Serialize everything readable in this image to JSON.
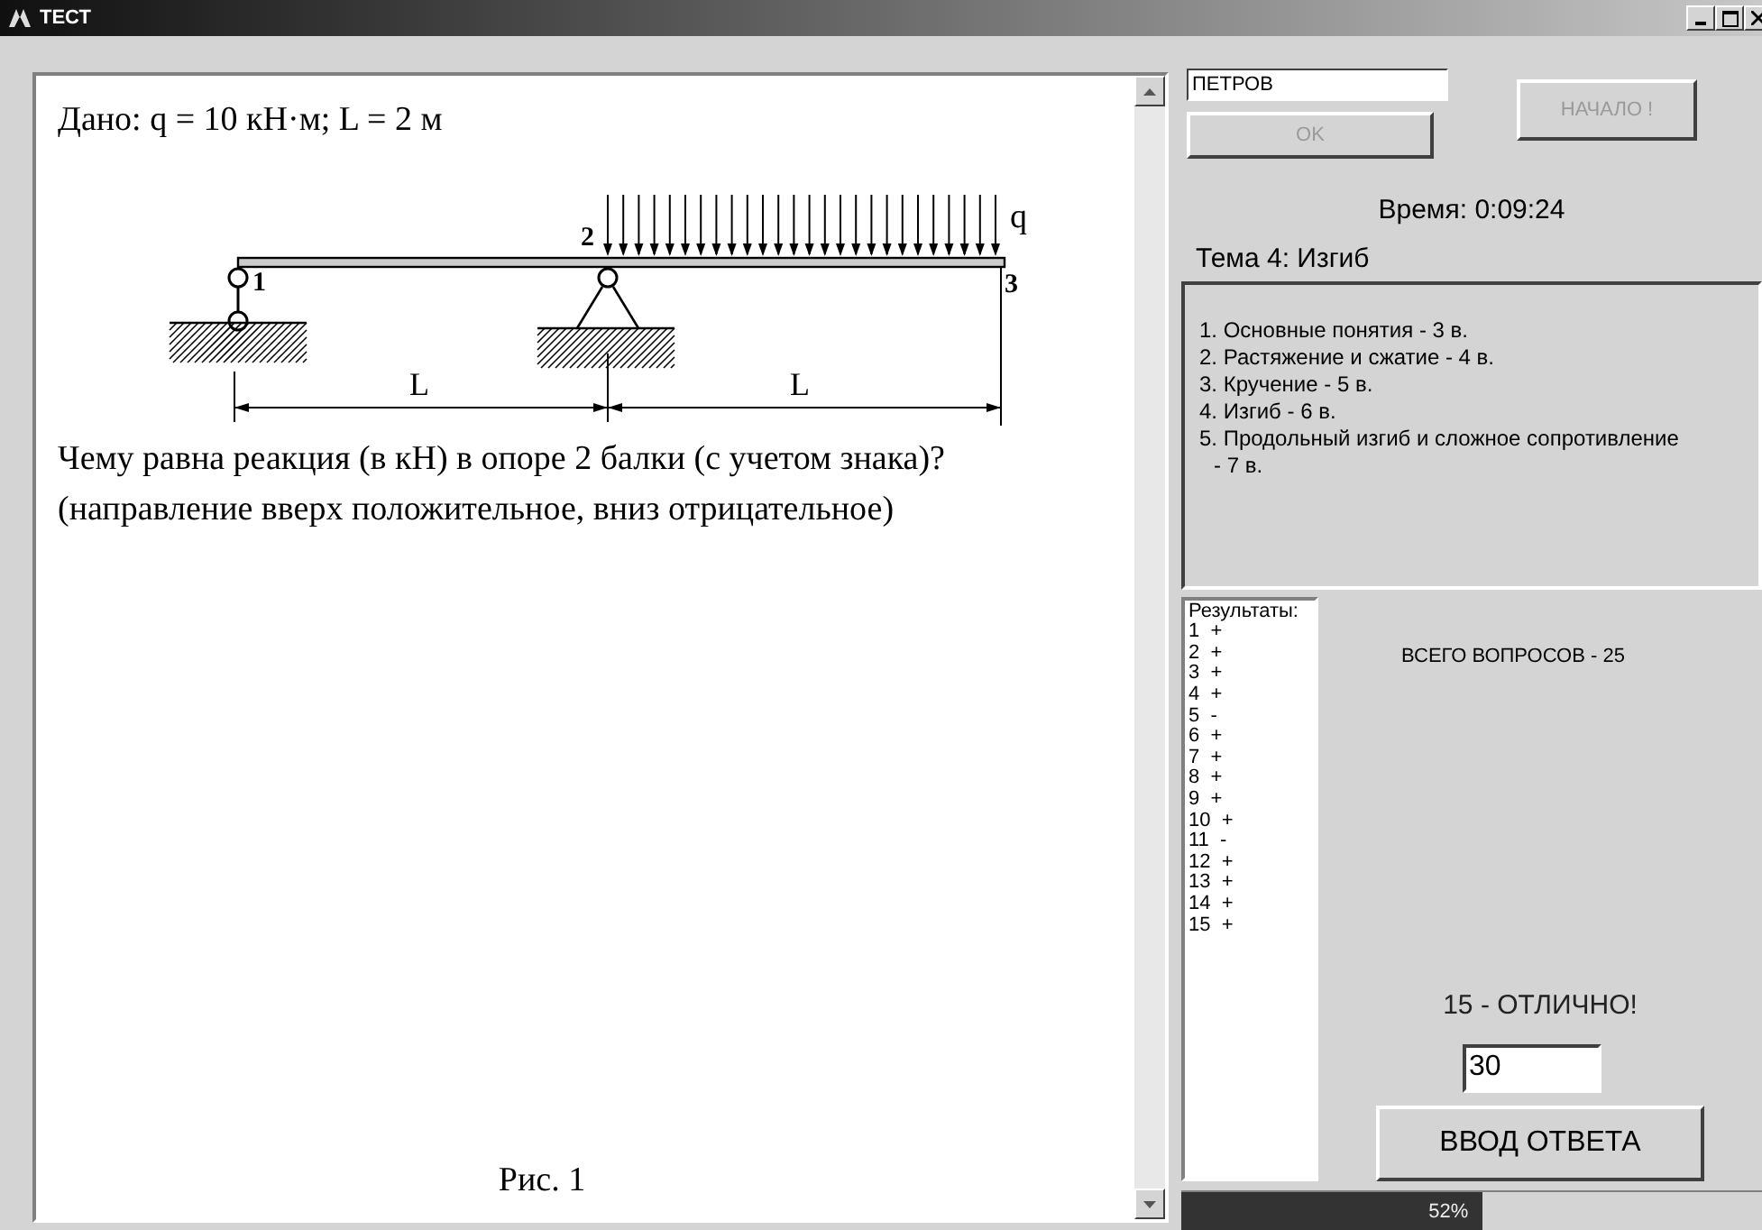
{
  "window": {
    "title": "ТЕСТ"
  },
  "question": {
    "given": "Дано: q = 10 кН·м; L = 2 м",
    "diagram": {
      "labels": {
        "node_1": "1",
        "node_2": "2",
        "node_3": "3",
        "load": "q",
        "span_1": "L",
        "span_2": "L"
      }
    },
    "text": "Чему равна реакция (в кН) в опоре 2 балки (с учетом знака)?",
    "note": "(направление вверх положительное, вниз отрицательное)",
    "caption": "Рис. 1"
  },
  "name_field": {
    "value": "ПЕТРОВ"
  },
  "buttons": {
    "ok": {
      "label": "OK",
      "disabled": true
    },
    "start": {
      "label": "НАЧАЛО !",
      "disabled": true
    }
  },
  "time": "Время: 0:09:24",
  "topic": "Тема 4: Изгиб",
  "topics": [
    "1. Основные понятия - 3 в.",
    "2. Растяжение и сжатие - 4 в.",
    "3. Кручение - 5 в.",
    "4. Изгиб - 6 в.",
    "5. Продольный изгиб и сложное сопротивление - 7 в."
  ],
  "results": {
    "title": "Результаты:",
    "items": [
      "1  +",
      "2  +",
      "3  +",
      "4  +",
      "5  -",
      "6  +",
      "7  +",
      "8  +",
      "9  +",
      "10  +",
      "11  -",
      "12  +",
      "13  +",
      "14  +",
      "15  +"
    ]
  },
  "total": "ВСЕГО ВОПРОСОВ - 25",
  "score": "15 - ОТЛИЧНО!",
  "answer": {
    "value": "30",
    "button": "ВВОД ОТВЕТА"
  },
  "progress": {
    "level": 0.52,
    "reading": "52%"
  }
}
